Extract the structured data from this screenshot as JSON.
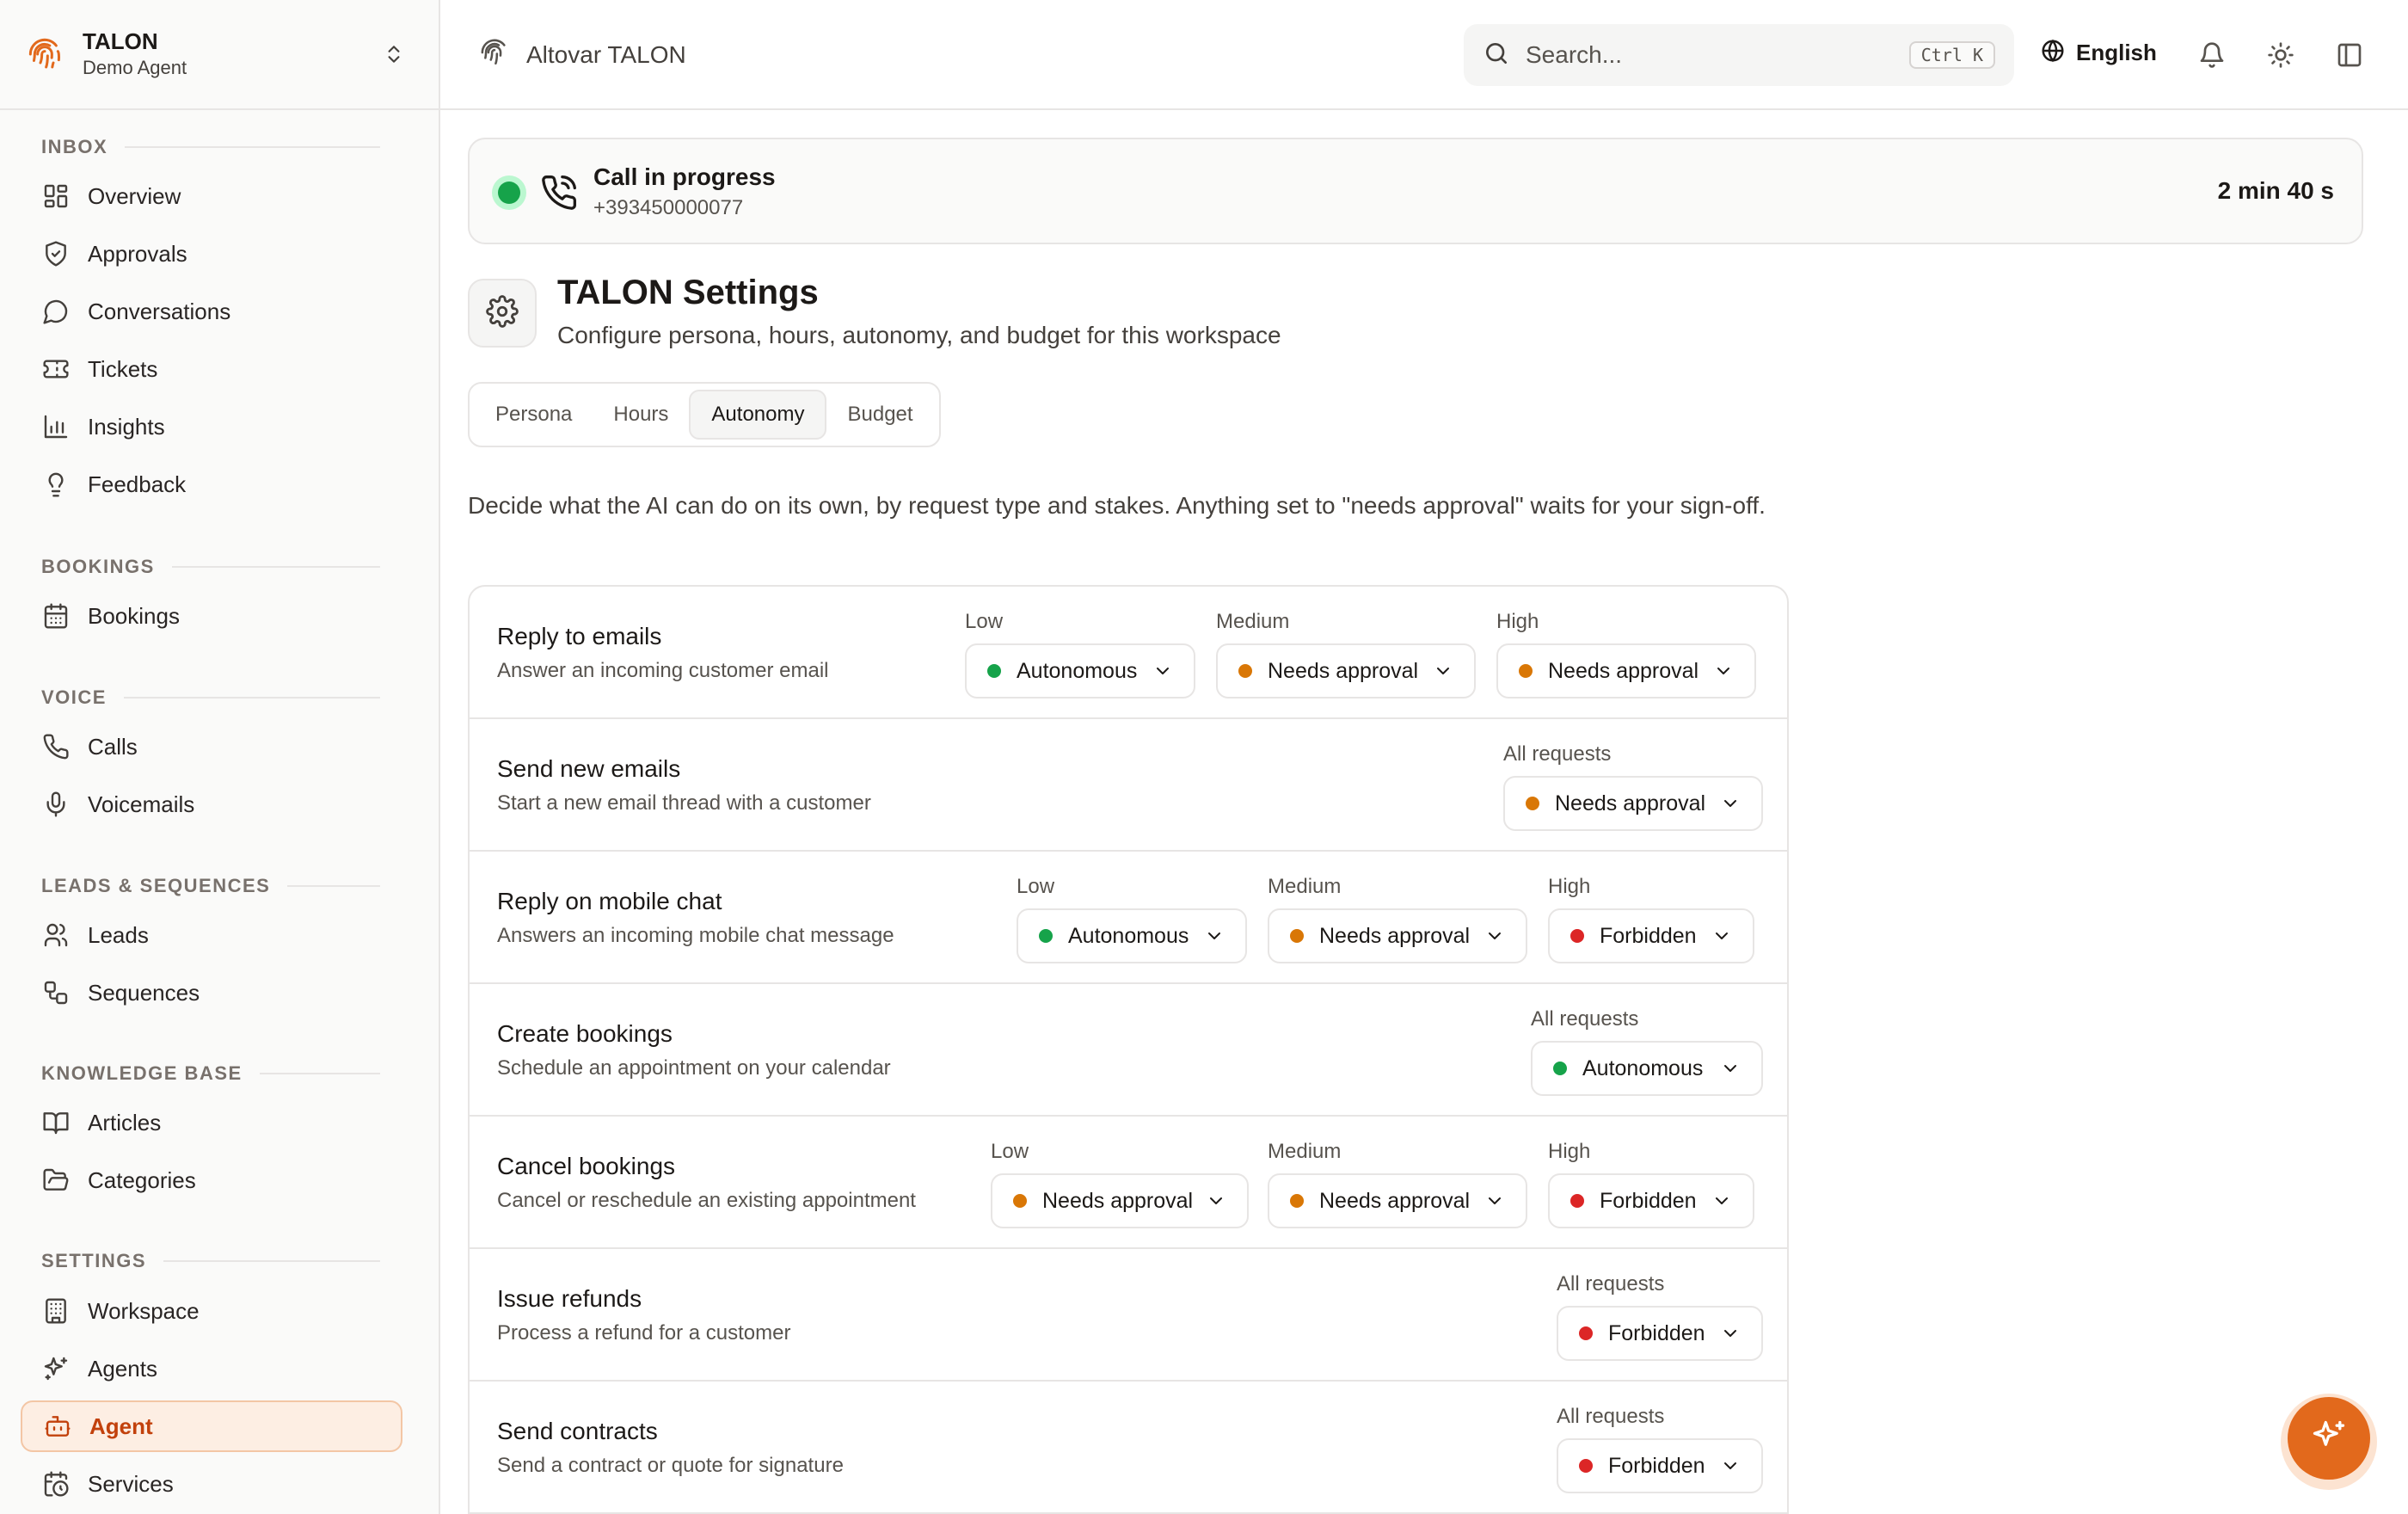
{
  "app": {
    "name": "TALON",
    "subtitle": "Demo Agent",
    "accent": "#e2691c"
  },
  "topbar": {
    "breadcrumb": "Altovar TALON",
    "search_placeholder": "Search...",
    "search_shortcut": "Ctrl K",
    "language": "English",
    "icons": [
      "globe-icon",
      "bell-icon",
      "sun-icon",
      "sidebar-toggle-icon"
    ]
  },
  "sidebar": {
    "sections": [
      {
        "title": "INBOX",
        "items": [
          {
            "label": "Overview",
            "icon": "grid-icon"
          },
          {
            "label": "Approvals",
            "icon": "shield-check-icon"
          },
          {
            "label": "Conversations",
            "icon": "chat-bubble-icon"
          },
          {
            "label": "Tickets",
            "icon": "ticket-icon"
          },
          {
            "label": "Insights",
            "icon": "bar-chart-icon"
          },
          {
            "label": "Feedback",
            "icon": "lightbulb-icon"
          }
        ]
      },
      {
        "title": "BOOKINGS",
        "items": [
          {
            "label": "Bookings",
            "icon": "calendar-icon"
          }
        ]
      },
      {
        "title": "VOICE",
        "items": [
          {
            "label": "Calls",
            "icon": "phone-icon"
          },
          {
            "label": "Voicemails",
            "icon": "microphone-icon"
          }
        ]
      },
      {
        "title": "LEADS & SEQUENCES",
        "items": [
          {
            "label": "Leads",
            "icon": "users-icon"
          },
          {
            "label": "Sequences",
            "icon": "sequence-icon"
          }
        ]
      },
      {
        "title": "KNOWLEDGE BASE",
        "items": [
          {
            "label": "Articles",
            "icon": "book-open-icon"
          },
          {
            "label": "Categories",
            "icon": "folder-open-icon"
          }
        ]
      },
      {
        "title": "SETTINGS",
        "items": [
          {
            "label": "Workspace",
            "icon": "building-icon"
          },
          {
            "label": "Agents",
            "icon": "sparkles-icon"
          },
          {
            "label": "Agent",
            "icon": "bot-icon",
            "active": true
          },
          {
            "label": "Services",
            "icon": "calendar-clock-icon"
          }
        ]
      }
    ]
  },
  "call": {
    "title": "Call in progress",
    "number": "+393450000077",
    "duration": "2 min 40 s",
    "status_color": "#16a34a"
  },
  "page": {
    "title": "TALON Settings",
    "subtitle": "Configure persona, hours, autonomy, and budget for this workspace",
    "tabs": [
      {
        "label": "Persona"
      },
      {
        "label": "Hours"
      },
      {
        "label": "Autonomy",
        "active": true
      },
      {
        "label": "Budget"
      }
    ],
    "intro": "Decide what the AI can do on its own, by request type and stakes. Anything set to \"needs approval\" waits for your sign-off."
  },
  "status_colors": {
    "Autonomous": "#16a34a",
    "Needs approval": "#d97706",
    "Forbidden": "#dc2626"
  },
  "autonomy_rules": [
    {
      "title": "Reply to emails",
      "description": "Answer an incoming customer email",
      "levels": [
        {
          "label": "Low",
          "value": "Autonomous"
        },
        {
          "label": "Medium",
          "value": "Needs approval"
        },
        {
          "label": "High",
          "value": "Needs approval"
        }
      ]
    },
    {
      "title": "Send new emails",
      "description": "Start a new email thread with a customer",
      "levels": [
        {
          "label": "All requests",
          "value": "Needs approval"
        }
      ]
    },
    {
      "title": "Reply on mobile chat",
      "description": "Answers an incoming mobile chat message",
      "levels": [
        {
          "label": "Low",
          "value": "Autonomous"
        },
        {
          "label": "Medium",
          "value": "Needs approval"
        },
        {
          "label": "High",
          "value": "Forbidden"
        }
      ]
    },
    {
      "title": "Create bookings",
      "description": "Schedule an appointment on your calendar",
      "levels": [
        {
          "label": "All requests",
          "value": "Autonomous"
        }
      ]
    },
    {
      "title": "Cancel bookings",
      "description": "Cancel or reschedule an existing appointment",
      "levels": [
        {
          "label": "Low",
          "value": "Needs approval"
        },
        {
          "label": "Medium",
          "value": "Needs approval"
        },
        {
          "label": "High",
          "value": "Forbidden"
        }
      ]
    },
    {
      "title": "Issue refunds",
      "description": "Process a refund for a customer",
      "levels": [
        {
          "label": "All requests",
          "value": "Forbidden"
        }
      ]
    },
    {
      "title": "Send contracts",
      "description": "Send a contract or quote for signature",
      "levels": [
        {
          "label": "All requests",
          "value": "Forbidden"
        }
      ]
    }
  ]
}
